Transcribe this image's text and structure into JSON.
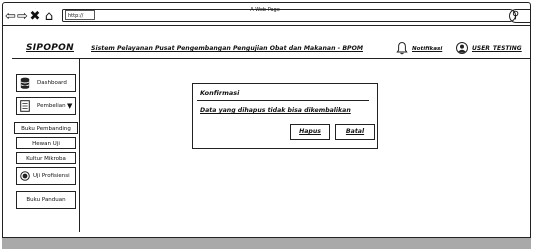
{
  "window": {
    "title": "A Web Page",
    "url": "http://"
  },
  "header": {
    "logo": "SIPOPON",
    "fullname": "Sistem Pelayanan Pusat Pengembangan Pengujian Obat dan Makanan - BPOM",
    "notification_label": "Notifikasi",
    "user_label": "USER_TESTING"
  },
  "sidebar": {
    "items": [
      {
        "label": "Dashboard",
        "icon": "database-icon"
      },
      {
        "label": "Pembelian",
        "icon": "list-icon",
        "dropdown": true
      },
      {
        "label": "Buku Pembanding"
      },
      {
        "label": "Hewan Uji"
      },
      {
        "label": "Kultur Mikroba"
      },
      {
        "label": "Uji Profisiensi",
        "icon": "radio-icon"
      },
      {
        "label": "Buku Panduan"
      }
    ]
  },
  "dialog": {
    "title": "Konfirmasi",
    "message": "Data yang dihapus tidak bisa dikembalikan",
    "confirm_label": "Hapus",
    "cancel_label": "Batal"
  },
  "colors": {
    "footer": "#a9a9a9",
    "border": "#222222"
  }
}
